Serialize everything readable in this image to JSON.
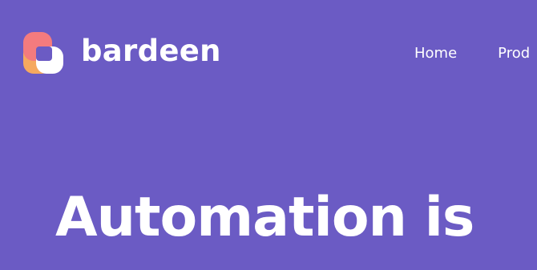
{
  "brand": {
    "name": "bardeen",
    "logo_colors": {
      "pink": "#f47b7e",
      "orange": "#f6a95f",
      "purple": "#6b5bc4",
      "white": "#ffffff"
    }
  },
  "nav": {
    "items": [
      {
        "label": "Home"
      },
      {
        "label": "Prod"
      }
    ]
  },
  "hero": {
    "title": "Automation is"
  },
  "colors": {
    "background": "#6b5bc4",
    "text": "#ffffff"
  }
}
